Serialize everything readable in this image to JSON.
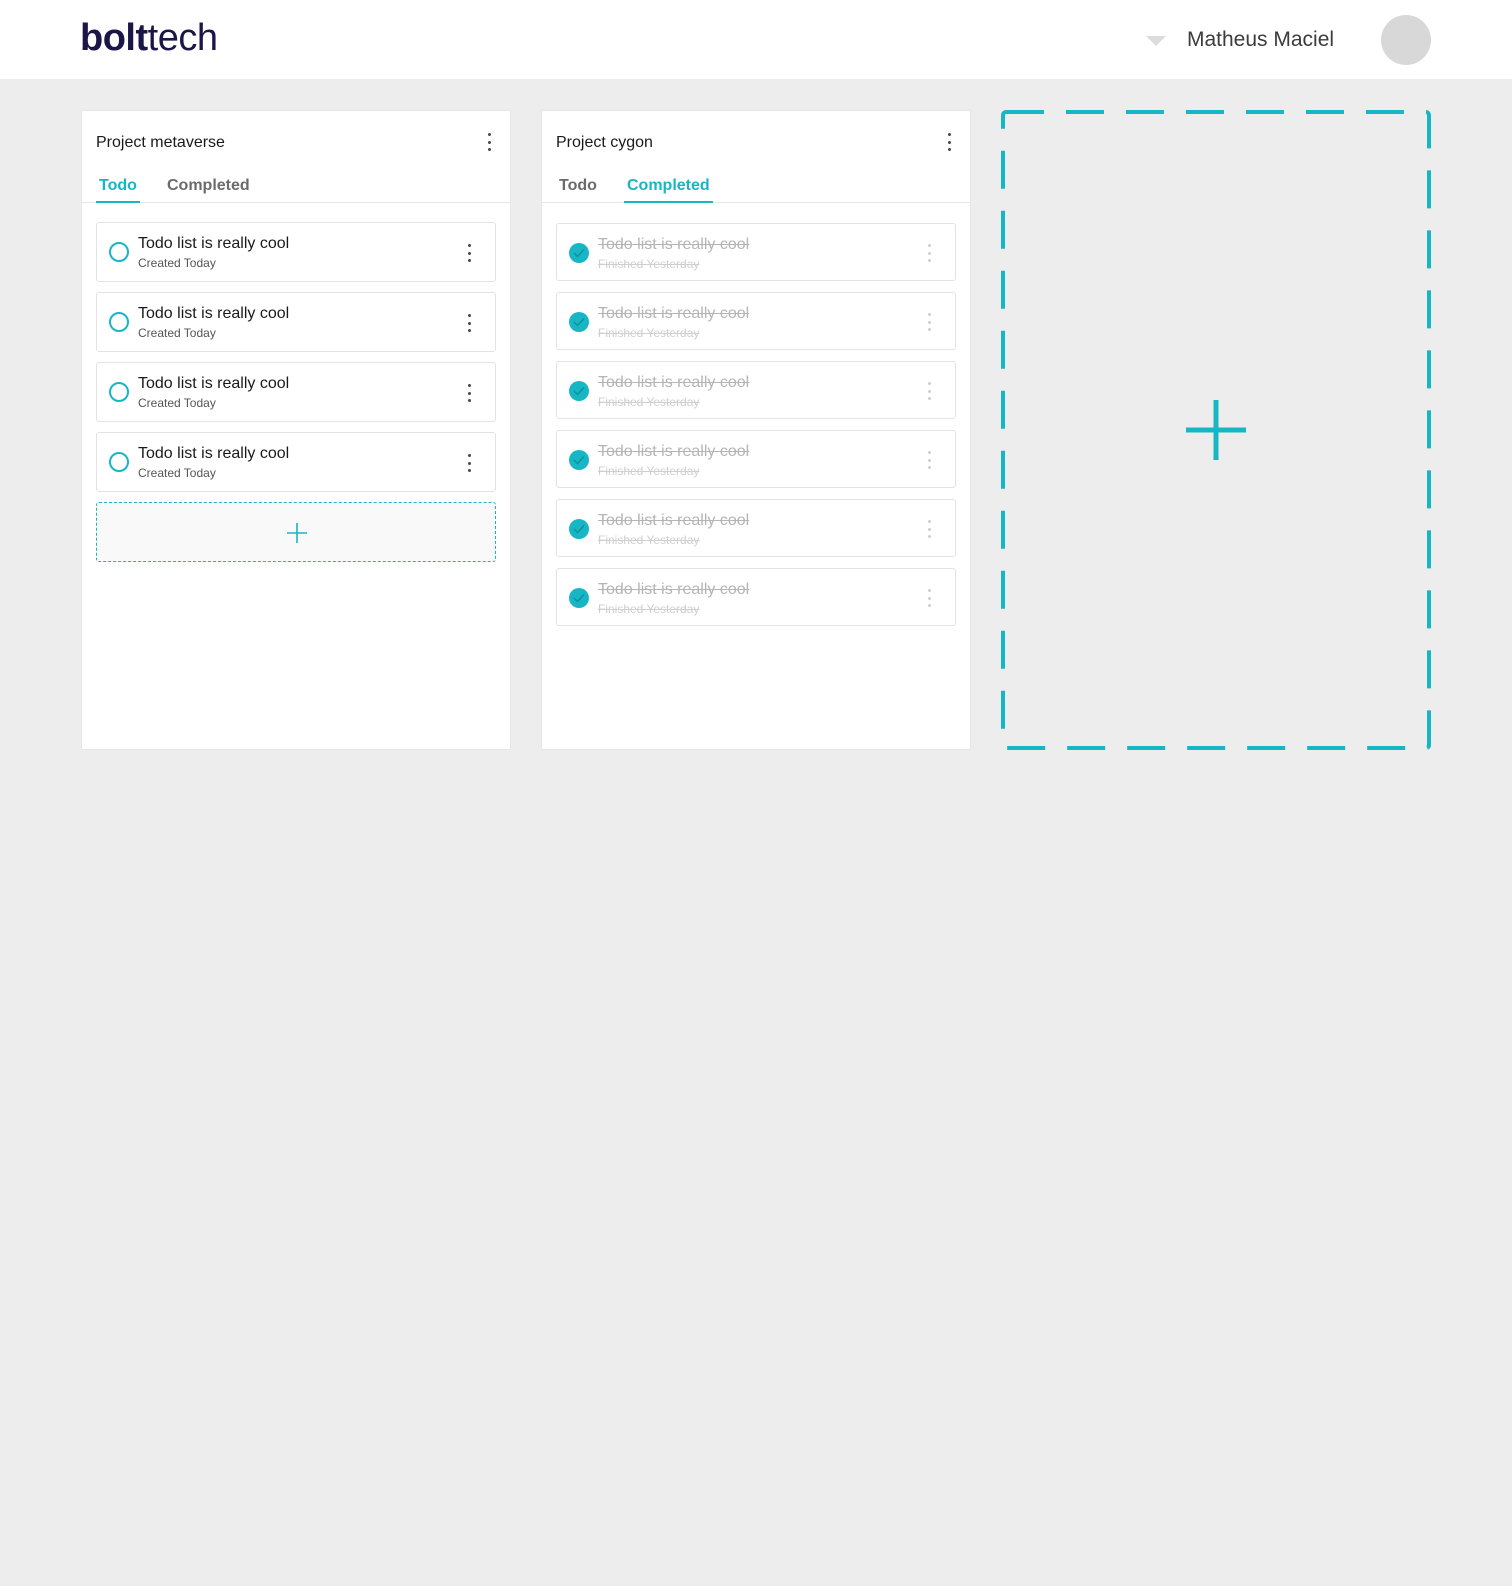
{
  "header": {
    "logo_bold": "bolt",
    "logo_light": "tech",
    "user_name": "Matheus Maciel"
  },
  "colors": {
    "accent": "#17b6c4",
    "brand": "#1b1647",
    "background": "#ededed"
  },
  "projects": [
    {
      "title": "Project metaverse",
      "active_tab": "Todo",
      "tabs": [
        "Todo",
        "Completed"
      ],
      "items": [
        {
          "title": "Todo list is really cool",
          "subtitle": "Created Today",
          "done": false
        },
        {
          "title": "Todo list is really cool",
          "subtitle": "Created Today",
          "done": false
        },
        {
          "title": "Todo list is really cool",
          "subtitle": "Created Today",
          "done": false
        },
        {
          "title": "Todo list is really cool",
          "subtitle": "Created Today",
          "done": false
        }
      ]
    },
    {
      "title": "Project cygon",
      "active_tab": "Completed",
      "tabs": [
        "Todo",
        "Completed"
      ],
      "items": [
        {
          "title": "Todo list is really cool",
          "subtitle": "Finished Yesterday",
          "done": true
        },
        {
          "title": "Todo list is really cool",
          "subtitle": "Finished Yesterday",
          "done": true
        },
        {
          "title": "Todo list is really cool",
          "subtitle": "Finished Yesterday",
          "done": true
        },
        {
          "title": "Todo list is really cool",
          "subtitle": "Finished Yesterday",
          "done": true
        },
        {
          "title": "Todo list is really cool",
          "subtitle": "Finished Yesterday",
          "done": true
        },
        {
          "title": "Todo list is really cool",
          "subtitle": "Finished Yesterday",
          "done": true
        }
      ]
    }
  ],
  "icons": {
    "menu": "kebab-menu-icon",
    "add": "plus-icon",
    "open": "circle-icon",
    "done": "check-circle-icon"
  }
}
